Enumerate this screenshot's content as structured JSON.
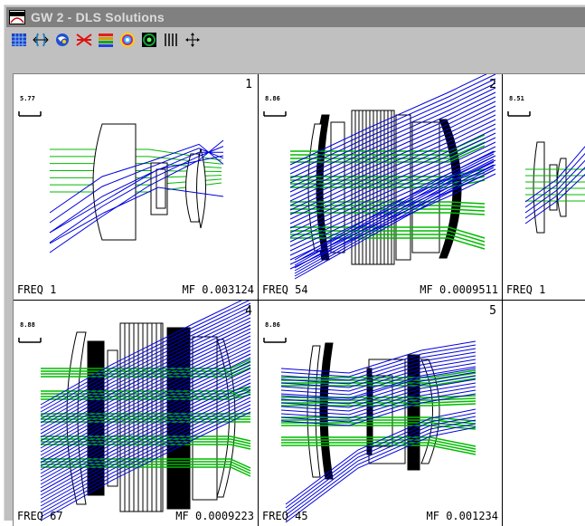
{
  "window": {
    "title": "GW 2 - DLS Solutions"
  },
  "toolbar": {
    "buttons": [
      {
        "name": "grid-view-icon",
        "color": "#1f3fbf"
      },
      {
        "name": "lens-arrows-icon",
        "color": "#1f7fbf"
      },
      {
        "name": "spot-diagram-icon",
        "color": "#2050d0"
      },
      {
        "name": "crossed-rays-icon",
        "color": "#e01010"
      },
      {
        "name": "color-bars-icon",
        "color": "#d0a000"
      },
      {
        "name": "target-rings-icon",
        "color": "#c020a0"
      },
      {
        "name": "psf-display-icon",
        "color": "#10a040"
      },
      {
        "name": "vertical-lines-icon",
        "color": "#000000"
      },
      {
        "name": "move-arrows-icon",
        "color": "#000000"
      }
    ]
  },
  "colors": {
    "ray_green": "#00bb00",
    "ray_blue": "#0000e0",
    "lens_line": "#000000"
  },
  "panels": [
    {
      "number": "1",
      "scale": "5.77",
      "freq": "FREQ 1",
      "mf": "MF 0.003124"
    },
    {
      "number": "2",
      "scale": "8.86",
      "freq": "FREQ 54",
      "mf": "MF 0.0009511"
    },
    {
      "number": "",
      "scale": "8.51",
      "freq": "FREQ 1",
      "mf": ""
    },
    {
      "number": "4",
      "scale": "8.88",
      "freq": "FREQ 67",
      "mf": "MF 0.0009223"
    },
    {
      "number": "5",
      "scale": "8.86",
      "freq": "FREQ 45",
      "mf": "MF 0.001234"
    },
    {
      "number": "",
      "scale": "",
      "freq": "",
      "mf": ""
    }
  ]
}
